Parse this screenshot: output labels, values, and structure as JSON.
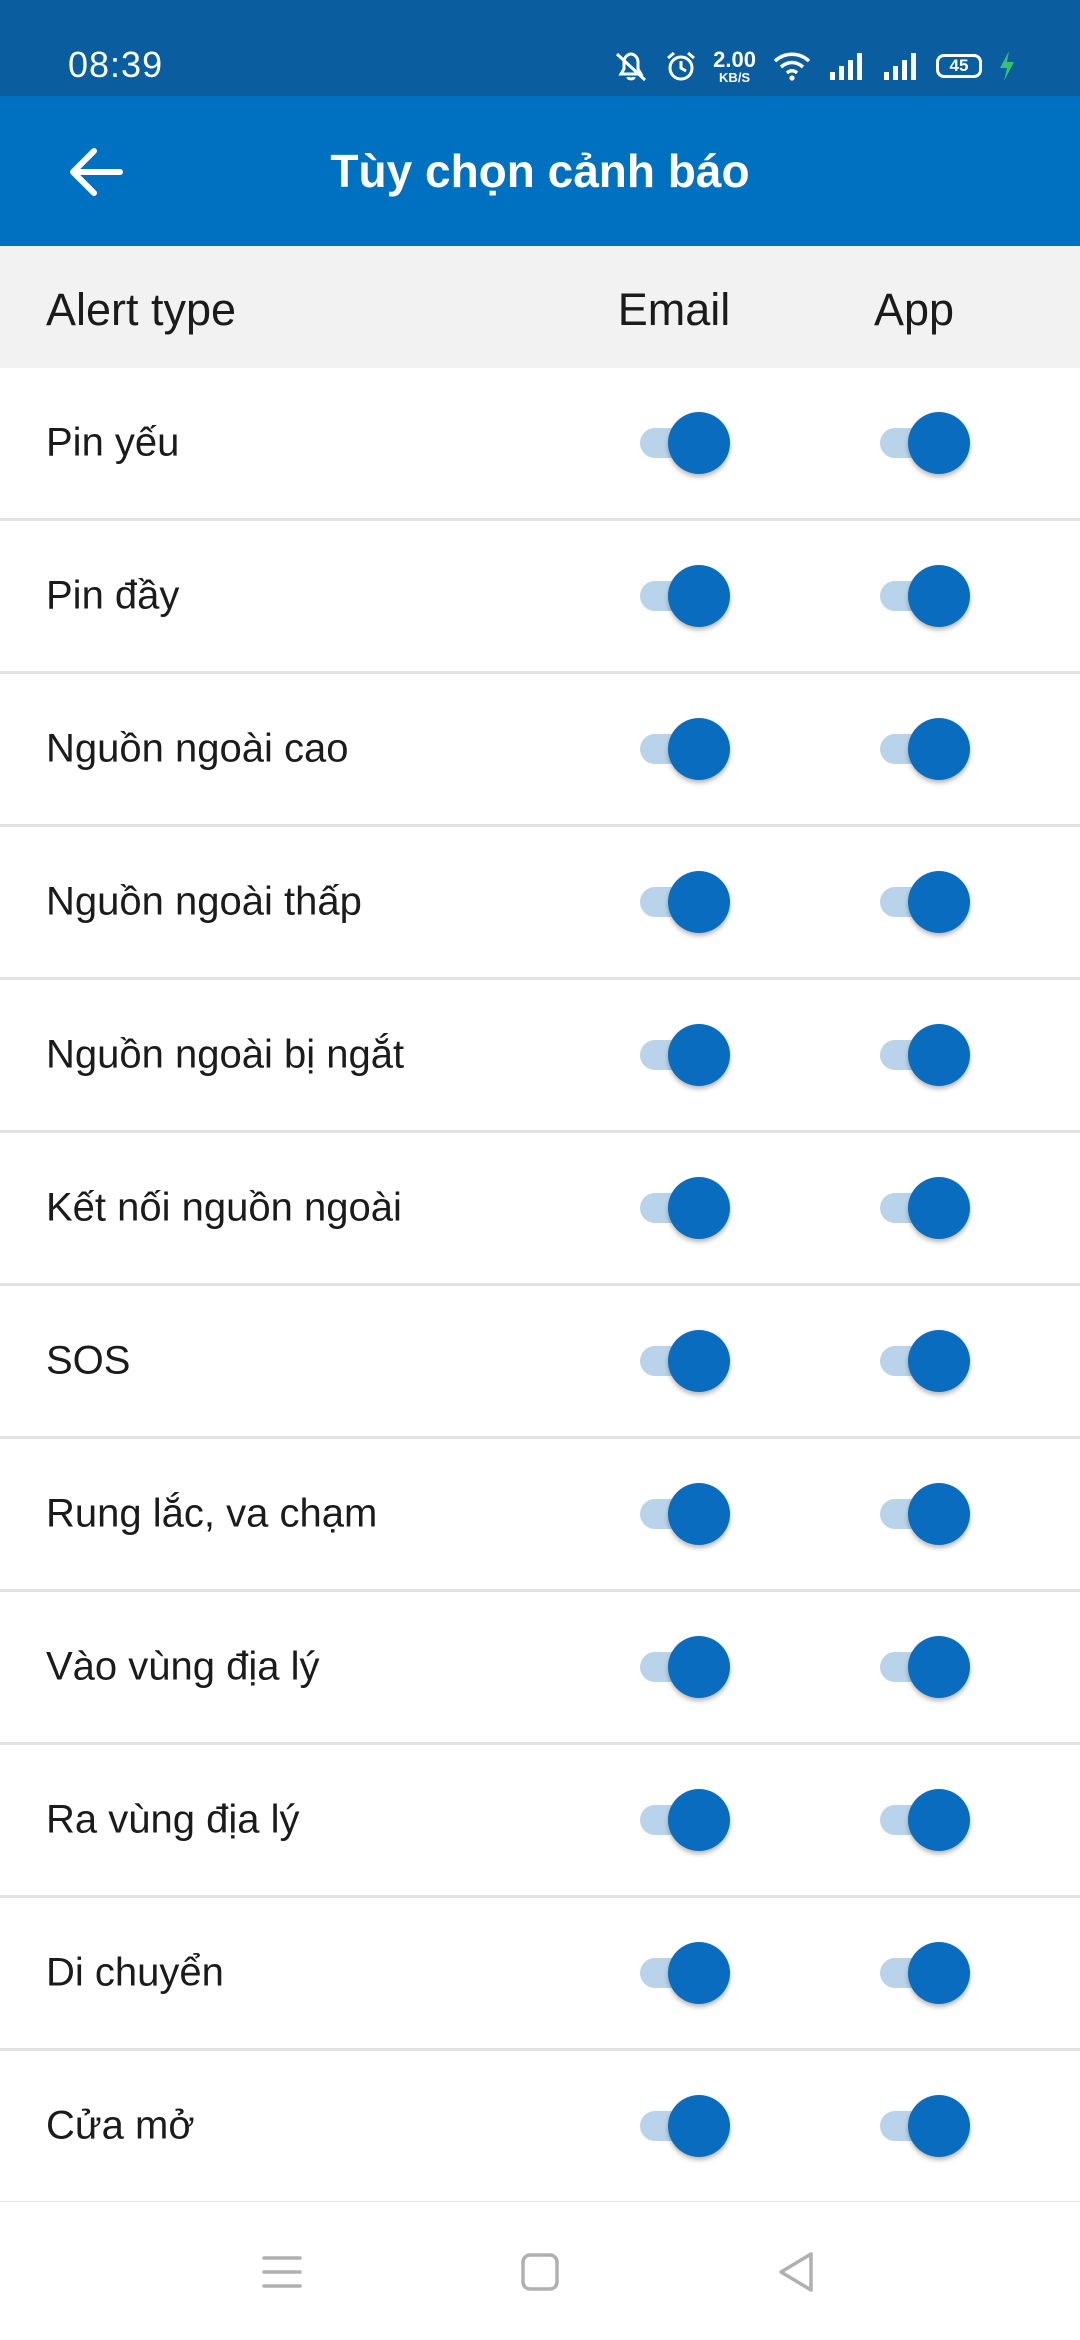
{
  "status_bar": {
    "time": "08:39",
    "net_speed_value": "2.00",
    "net_speed_unit": "KB/S",
    "battery_level": "45",
    "icons": [
      "mute-bell-icon",
      "alarm-icon",
      "wifi-icon",
      "signal-icon",
      "signal-icon",
      "battery-icon",
      "charging-icon"
    ]
  },
  "app_bar": {
    "title": "Tùy chọn cảnh báo",
    "back_icon": "arrow-left-icon"
  },
  "table": {
    "headers": {
      "type": "Alert type",
      "email": "Email",
      "app": "App"
    },
    "rows": [
      {
        "label": "Pin yếu",
        "email": true,
        "app": true
      },
      {
        "label": "Pin đầy",
        "email": true,
        "app": true
      },
      {
        "label": "Nguồn ngoài cao",
        "email": true,
        "app": true
      },
      {
        "label": "Nguồn ngoài thấp",
        "email": true,
        "app": true
      },
      {
        "label": "Nguồn ngoài bị ngắt",
        "email": true,
        "app": true
      },
      {
        "label": "Kết nối nguồn ngoài",
        "email": true,
        "app": true
      },
      {
        "label": "SOS",
        "email": true,
        "app": true
      },
      {
        "label": "Rung lắc, va chạm",
        "email": true,
        "app": true
      },
      {
        "label": "Vào vùng địa lý",
        "email": true,
        "app": true
      },
      {
        "label": "Ra vùng địa lý",
        "email": true,
        "app": true
      },
      {
        "label": "Di chuyển",
        "email": true,
        "app": true
      },
      {
        "label": "Cửa mở",
        "email": true,
        "app": true
      }
    ]
  },
  "colors": {
    "status_bar": "#0a5d9e",
    "app_bar": "#0070c0",
    "switch_thumb_on": "#0a6cbe",
    "switch_track_on": "#b9d4ea",
    "header_bg": "#f2f2f2"
  },
  "nav_bar": {
    "icons": [
      "menu-icon",
      "home-square-icon",
      "back-triangle-icon"
    ]
  }
}
